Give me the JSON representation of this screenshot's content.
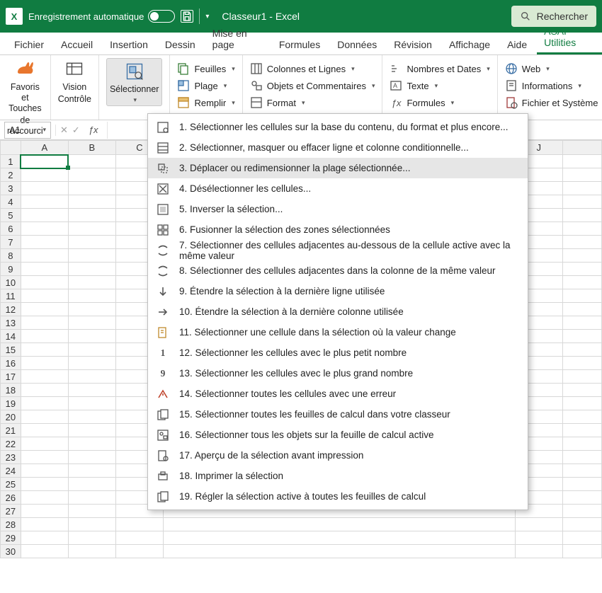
{
  "titlebar": {
    "autosave_label": "Enregistrement automatique",
    "title": "Classeur1  -  Excel",
    "search_label": "Rechercher"
  },
  "tabs": {
    "file": "Fichier",
    "home": "Accueil",
    "insert": "Insertion",
    "draw": "Dessin",
    "layout": "Mise en page",
    "formulas": "Formules",
    "data": "Données",
    "review": "Révision",
    "view": "Affichage",
    "help": "Aide",
    "asap": "ASAP Utilities"
  },
  "ribbon": {
    "favoris_line1": "Favoris et Touches",
    "favoris_line2": "de raccourci",
    "favoris_caption": "Favoris",
    "vision_line1": "Vision",
    "vision_line2": "Contrôle",
    "select_line1": "Sélectionner",
    "feuilles": "Feuilles",
    "plage": "Plage",
    "remplir": "Remplir",
    "colonnes": "Colonnes et Lignes",
    "objets": "Objets et Commentaires",
    "format": "Format",
    "nombres": "Nombres et Dates",
    "texte": "Texte",
    "formules": "Formules",
    "web": "Web",
    "informations": "Informations",
    "fichier_sys": "Fichier et Système"
  },
  "formula": {
    "namebox": "A1"
  },
  "columns": [
    "A",
    "B",
    "C",
    "J"
  ],
  "rows": [
    "1",
    "2",
    "3",
    "4",
    "5",
    "6",
    "7",
    "8",
    "9",
    "10",
    "11",
    "12",
    "13",
    "14",
    "15",
    "16",
    "17",
    "18",
    "19",
    "20",
    "21",
    "22",
    "23",
    "24",
    "25",
    "26",
    "27",
    "28",
    "29",
    "30"
  ],
  "menu": [
    {
      "n": "1.",
      "t": "Sélectionner les cellules sur la base du contenu, du format et plus encore..."
    },
    {
      "n": "2.",
      "t": "Sélectionner, masquer ou effacer ligne et colonne conditionnelle..."
    },
    {
      "n": "3.",
      "t": "Déplacer ou redimensionner la plage sélectionnée..."
    },
    {
      "n": "4.",
      "t": "Désélectionner les cellules..."
    },
    {
      "n": "5.",
      "t": "Inverser la sélection..."
    },
    {
      "n": "6.",
      "t": "Fusionner la sélection des zones sélectionnées"
    },
    {
      "n": "7.",
      "t": "Sélectionner des cellules adjacentes au-dessous de la cellule active avec la même valeur"
    },
    {
      "n": "8.",
      "t": "Sélectionner des cellules adjacentes dans la colonne de la même valeur"
    },
    {
      "n": "9.",
      "t": "Étendre la sélection à la dernière ligne utilisée"
    },
    {
      "n": "10.",
      "t": "Étendre la sélection à la dernière colonne utilisée"
    },
    {
      "n": "11.",
      "t": "Sélectionner une cellule dans la sélection où la valeur change"
    },
    {
      "n": "12.",
      "t": "Sélectionner les cellules avec le plus petit nombre"
    },
    {
      "n": "13.",
      "t": "Sélectionner les cellules avec le plus grand nombre"
    },
    {
      "n": "14.",
      "t": "Sélectionner toutes les cellules avec une erreur"
    },
    {
      "n": "15.",
      "t": "Sélectionner toutes les feuilles de calcul dans votre classeur"
    },
    {
      "n": "16.",
      "t": "Sélectionner tous les objets sur la feuille de calcul active"
    },
    {
      "n": "17.",
      "t": "Aperçu de la sélection avant impression"
    },
    {
      "n": "18.",
      "t": "Imprimer la sélection"
    },
    {
      "n": "19.",
      "t": "Régler la sélection active à toutes les feuilles de calcul"
    }
  ]
}
